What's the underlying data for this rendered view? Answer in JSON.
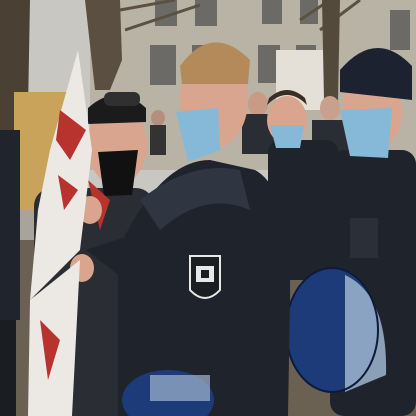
{
  "photo": {
    "subject": "police-officers-and-protester",
    "palette": {
      "sky": "#c9c7c2",
      "building": "#b9b3a6",
      "window": "#6c6a66",
      "tree": "#4a4134",
      "ground": "#6b6152",
      "plywood": "#c9a35a",
      "uniform": "#1f242c",
      "uniform_highlight": "#2f3641",
      "skin": "#d9a58f",
      "hair": "#b58a5a",
      "mask_blue": "#86b8d8",
      "mask_black": "#111111",
      "helmet_blue": "#1c3b78",
      "visor": "#9fb6cf",
      "flag_white": "#ece9e4",
      "flag_red": "#b8322e",
      "badge_white": "#e8e8e8"
    }
  }
}
